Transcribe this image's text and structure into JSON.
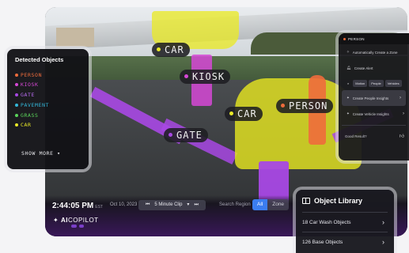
{
  "colors": {
    "car": "#e9e928",
    "kiosk": "#d648d6",
    "person": "#ee6c3c",
    "gate": "#a848e4",
    "pavement": "#33b7d9",
    "grass": "#5ad35a",
    "accent": "#3b7df0",
    "brand_purple": "#7a3fc8"
  },
  "overlay_tags": {
    "car_top": "CAR",
    "kiosk": "KIOSK",
    "car_van": "CAR",
    "person": "PERSON",
    "gate": "GATE"
  },
  "detected_panel": {
    "title": "Detected Objects",
    "items": [
      {
        "label": "PERSON",
        "color": "#ee6c3c"
      },
      {
        "label": "KIOSK",
        "color": "#d648d6"
      },
      {
        "label": "GATE",
        "color": "#a848e4"
      },
      {
        "label": "PAVEMENT",
        "color": "#33b7d9"
      },
      {
        "label": "GRASS",
        "color": "#5ad35a"
      },
      {
        "label": "CAR",
        "color": "#e9e928"
      }
    ],
    "show_more": "SHOW MORE"
  },
  "right_panel": {
    "header": "PERSON",
    "items": [
      {
        "label": "Automatically Create a Zone",
        "icon": "sparkle-icon"
      },
      {
        "label": "Create Alert",
        "icon": "bell-icon"
      }
    ],
    "chips": [
      "Motion",
      "People",
      "Vehicles"
    ],
    "insight_items": [
      {
        "label": "Create People Insights",
        "icon": "sparkle-icon"
      },
      {
        "label": "Create Vehicle Insights",
        "icon": "sparkle-icon"
      }
    ],
    "feedback": "Good Result?"
  },
  "controls": {
    "time": "2:44:05 PM",
    "timezone": "EST",
    "date": "Oct 10, 2023",
    "clip": "5 Minute Clip",
    "search_region_label": "Search Region",
    "segments": [
      {
        "label": "All",
        "active": true
      },
      {
        "label": "Zone",
        "active": false
      }
    ]
  },
  "brand": {
    "name_a": "AI",
    "name_b": "COPILOT"
  },
  "library": {
    "title": "Object Library",
    "items": [
      "18 Car Wash Objects",
      "126 Base Objects"
    ]
  }
}
